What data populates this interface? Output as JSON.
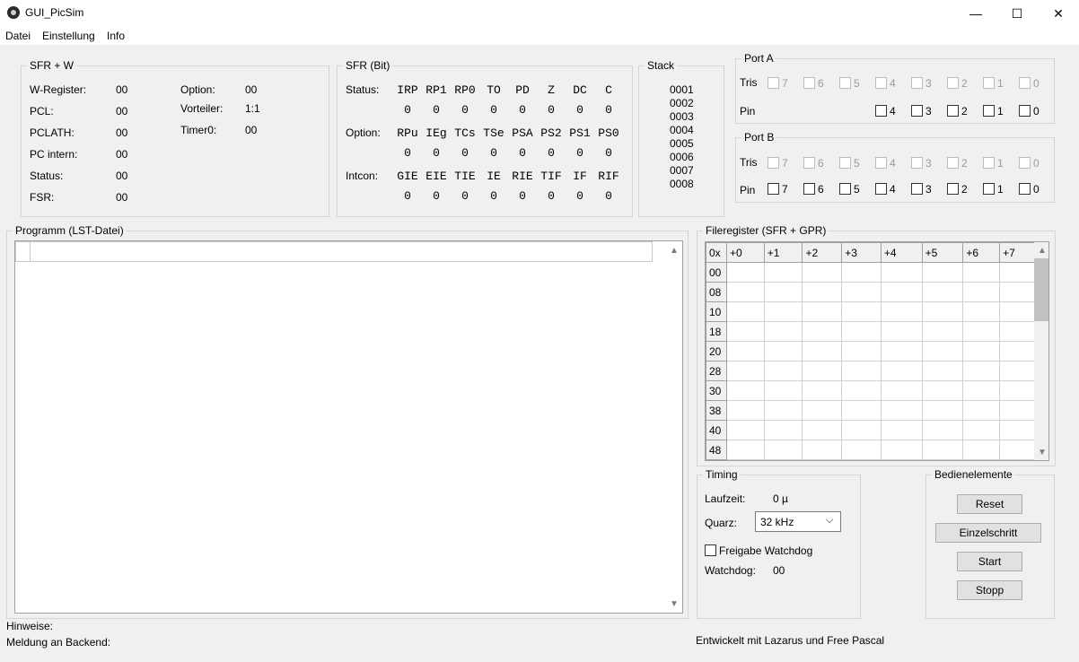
{
  "window": {
    "title": "GUI_PicSim",
    "minimize": "—",
    "maximize": "☐",
    "close": "✕"
  },
  "menu": [
    "Datei",
    "Einstellung",
    "Info"
  ],
  "sfr_w": {
    "legend": "SFR + W",
    "left": [
      {
        "label": "W-Register:",
        "value": "00"
      },
      {
        "label": "PCL:",
        "value": "00"
      },
      {
        "label": "PCLATH:",
        "value": "00"
      },
      {
        "label": "PC intern:",
        "value": "00"
      },
      {
        "label": "Status:",
        "value": "00"
      },
      {
        "label": "FSR:",
        "value": "00"
      }
    ],
    "right": [
      {
        "label": "Option:",
        "value": "00"
      },
      {
        "label": "Vorteiler:",
        "value": "1:1"
      },
      {
        "label": "Timer0:",
        "value": "00"
      }
    ]
  },
  "sfr_bit": {
    "legend": "SFR (Bit)",
    "rows": [
      {
        "label": "Status:",
        "bits": [
          "IRP",
          "RP1",
          "RP0",
          "TO",
          "PD",
          "Z",
          "DC",
          "C"
        ],
        "values": [
          "0",
          "0",
          "0",
          "0",
          "0",
          "0",
          "0",
          "0"
        ]
      },
      {
        "label": "Option:",
        "bits": [
          "RPu",
          "IEg",
          "TCs",
          "TSe",
          "PSA",
          "PS2",
          "PS1",
          "PS0"
        ],
        "values": [
          "0",
          "0",
          "0",
          "0",
          "0",
          "0",
          "0",
          "0"
        ]
      },
      {
        "label": "Intcon:",
        "bits": [
          "GIE",
          "EIE",
          "TIE",
          "IE",
          "RIE",
          "TIF",
          "IF",
          "RIF"
        ],
        "values": [
          "0",
          "0",
          "0",
          "0",
          "0",
          "0",
          "0",
          "0"
        ]
      }
    ]
  },
  "stack": {
    "legend": "Stack",
    "entries": [
      "0001",
      "0002",
      "0003",
      "0004",
      "0005",
      "0006",
      "0007",
      "0008"
    ]
  },
  "port_a": {
    "legend": "Port A",
    "tris_label": "Tris",
    "pin_label": "Pin",
    "tris": [
      "7",
      "6",
      "5",
      "4",
      "3",
      "2",
      "1",
      "0"
    ],
    "pin": [
      "4",
      "3",
      "2",
      "1",
      "0"
    ]
  },
  "port_b": {
    "legend": "Port B",
    "tris_label": "Tris",
    "pin_label": "Pin",
    "tris": [
      "7",
      "6",
      "5",
      "4",
      "3",
      "2",
      "1",
      "0"
    ],
    "pin": [
      "7",
      "6",
      "5",
      "4",
      "3",
      "2",
      "1",
      "0"
    ]
  },
  "program": {
    "legend": "Programm (LST-Datei)"
  },
  "fileregister": {
    "legend": "Fileregister (SFR + GPR)",
    "corner": "0x",
    "columns": [
      "+0",
      "+1",
      "+2",
      "+3",
      "+4",
      "+5",
      "+6",
      "+7"
    ],
    "rows": [
      "00",
      "08",
      "10",
      "18",
      "20",
      "28",
      "30",
      "38",
      "40",
      "48"
    ]
  },
  "timing": {
    "legend": "Timing",
    "runtime_label": "Laufzeit:",
    "runtime_value": "0 µ",
    "quartz_label": "Quarz:",
    "quartz_value": "32 kHz",
    "watchdog_enable": "Freigabe Watchdog",
    "watchdog_label": "Watchdog:",
    "watchdog_value": "00"
  },
  "controls": {
    "legend": "Bedienelemente",
    "reset": "Reset",
    "step": "Einzelschritt",
    "start": "Start",
    "stop": "Stopp"
  },
  "footer": {
    "hints": "Hinweise:",
    "backend": "Meldung an Backend:",
    "credits": "Entwickelt mit Lazarus und Free Pascal"
  }
}
